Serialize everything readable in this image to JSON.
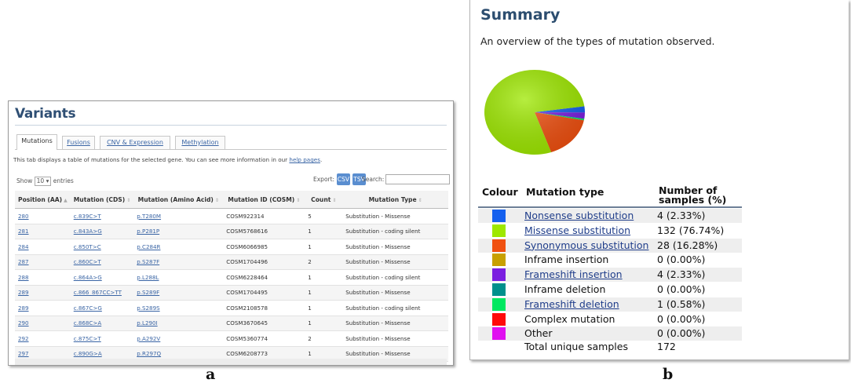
{
  "panel_a": {
    "title": "Variants",
    "tabs": [
      "Mutations",
      "Fusions",
      "CNV & Expression",
      "Methylation"
    ],
    "description": "This tab displays a table of mutations for the selected gene. You can see more information in our",
    "description_link": "help pages",
    "description_end": ".",
    "show_label": "Show",
    "show_value": "10",
    "entries_label": "entries",
    "export_label": "Export:",
    "csv_button": "CSV",
    "tsv_button": "TSV",
    "search_label": "Search:",
    "columns": [
      "Position (AA)",
      "Mutation (CDS)",
      "Mutation (Amino Acid)",
      "Mutation ID (COSM)",
      "Count",
      "Mutation Type"
    ],
    "rows": [
      [
        "280",
        "c.839C>T",
        "p.T280M",
        "COSM922314",
        "5",
        "Substitution - Missense"
      ],
      [
        "281",
        "c.843A>G",
        "p.P281P",
        "COSM5768616",
        "1",
        "Substitution - coding silent"
      ],
      [
        "284",
        "c.850T>C",
        "p.C284R",
        "COSM6066985",
        "1",
        "Substitution - Missense"
      ],
      [
        "287",
        "c.860C>T",
        "p.S287F",
        "COSM1704496",
        "2",
        "Substitution - Missense"
      ],
      [
        "288",
        "c.864A>G",
        "p.L288L",
        "COSM6228464",
        "1",
        "Substitution - coding silent"
      ],
      [
        "289",
        "c.866_867CC>TT",
        "p.S289F",
        "COSM1704495",
        "1",
        "Substitution - Missense"
      ],
      [
        "289",
        "c.867C>G",
        "p.S289S",
        "COSM2108578",
        "1",
        "Substitution - coding silent"
      ],
      [
        "290",
        "c.868C>A",
        "p.L290I",
        "COSM3670645",
        "1",
        "Substitution - Missense"
      ],
      [
        "292",
        "c.875C>T",
        "p.A292V",
        "COSM5360774",
        "2",
        "Substitution - Missense"
      ],
      [
        "297",
        "c.890G>A",
        "p.R297Q",
        "COSM6208773",
        "1",
        "Substitution - Missense"
      ]
    ]
  },
  "panel_b": {
    "title": "Summary",
    "subtitle": "An overview of the types of mutation observed.",
    "header_colour": "Colour",
    "header_type": "Mutation type",
    "header_number_1": "Number of",
    "header_number_2": "samples (%)",
    "rows": [
      {
        "type": "Nonsense substitution",
        "count": "4 (2.33%)",
        "color": "#1560ee",
        "link": true,
        "value": 4
      },
      {
        "type": "Missense substitution",
        "count": "132 (76.74%)",
        "color": "#9ee800",
        "link": true,
        "value": 132
      },
      {
        "type": "Synonymous substitution",
        "count": "28 (16.28%)",
        "color": "#f05010",
        "link": true,
        "value": 28
      },
      {
        "type": "Inframe insertion",
        "count": "0 (0.00%)",
        "color": "#c8a000",
        "link": false,
        "value": 0
      },
      {
        "type": "Frameshift insertion",
        "count": "4 (2.33%)",
        "color": "#7b1ee0",
        "link": true,
        "value": 4
      },
      {
        "type": "Inframe deletion",
        "count": "0 (0.00%)",
        "color": "#00908c",
        "link": false,
        "value": 0
      },
      {
        "type": "Frameshift deletion",
        "count": "1 (0.58%)",
        "color": "#00e860",
        "link": true,
        "value": 1
      },
      {
        "type": "Complex mutation",
        "count": "0 (0.00%)",
        "color": "#ff0a0a",
        "link": false,
        "value": 0
      },
      {
        "type": "Other",
        "count": "0 (0.00%)",
        "color": "#e010f0",
        "link": false,
        "value": 0
      }
    ],
    "total_label": "Total unique samples",
    "total_value": "172"
  },
  "chart_data": {
    "type": "pie",
    "categories": [
      "Nonsense substitution",
      "Missense substitution",
      "Synonymous substitution",
      "Inframe insertion",
      "Frameshift insertion",
      "Inframe deletion",
      "Frameshift deletion",
      "Complex mutation",
      "Other"
    ],
    "values": [
      4,
      132,
      28,
      0,
      4,
      0,
      1,
      0,
      0
    ],
    "colors": [
      "#1560ee",
      "#9ee800",
      "#f05010",
      "#c8a000",
      "#7b1ee0",
      "#00908c",
      "#00e860",
      "#ff0a0a",
      "#e010f0"
    ]
  },
  "figure_labels": {
    "a": "a",
    "b": "b"
  }
}
